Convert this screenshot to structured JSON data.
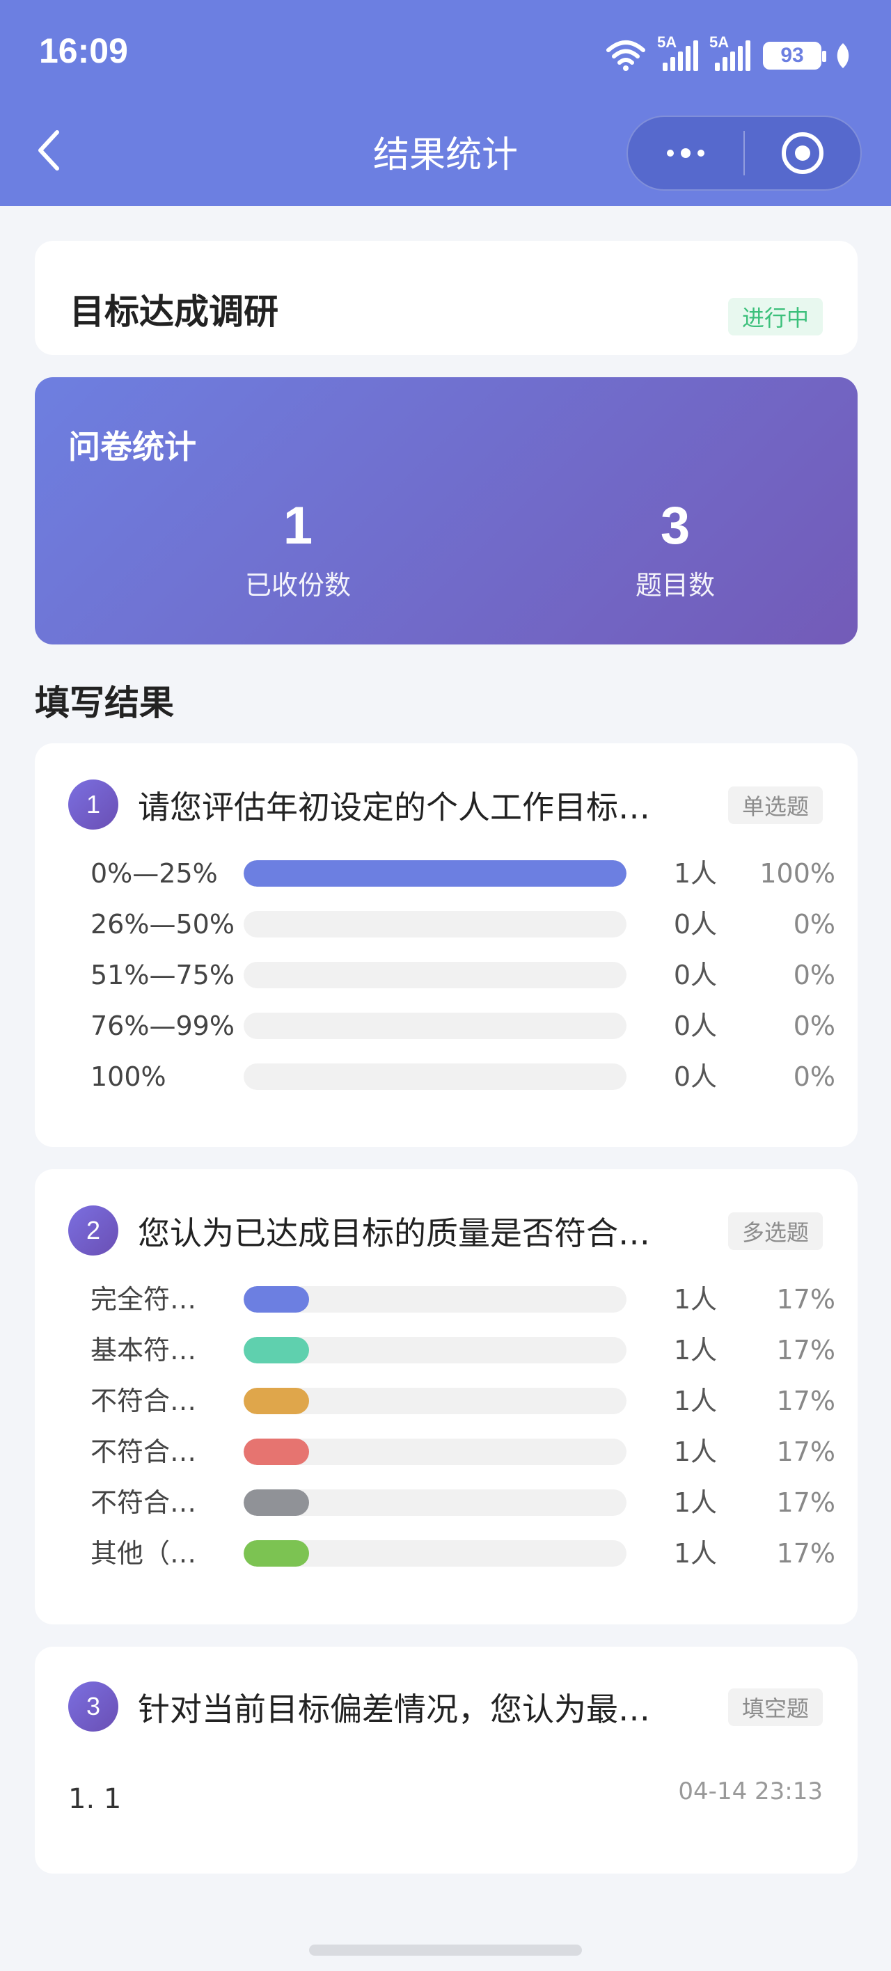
{
  "status_bar": {
    "time": "16:09",
    "signal1_label": "5A",
    "signal2_label": "5A",
    "battery": "93"
  },
  "nav": {
    "title": "结果统计"
  },
  "survey": {
    "title": "目标达成调研",
    "status": "进行中"
  },
  "stats": {
    "title": "问卷统计",
    "collected_value": "1",
    "collected_label": "已收份数",
    "questions_value": "3",
    "questions_label": "题目数"
  },
  "results_title": "填写结果",
  "questions": [
    {
      "number": "1",
      "text": "请您评估年初设定的个人工作目标…",
      "type": "单选题",
      "options": [
        {
          "label": "0%—25%",
          "count": "1人",
          "percent": "100%",
          "fraction": 1.0,
          "color": "#6c7fe1"
        },
        {
          "label": "26%—50%",
          "count": "0人",
          "percent": "0%",
          "fraction": 0,
          "color": "#6c7fe1"
        },
        {
          "label": "51%—75%",
          "count": "0人",
          "percent": "0%",
          "fraction": 0,
          "color": "#6c7fe1"
        },
        {
          "label": "76%—99%",
          "count": "0人",
          "percent": "0%",
          "fraction": 0,
          "color": "#6c7fe1"
        },
        {
          "label": "100%",
          "count": "0人",
          "percent": "0%",
          "fraction": 0,
          "color": "#6c7fe1"
        }
      ]
    },
    {
      "number": "2",
      "text": "您认为已达成目标的质量是否符合…",
      "type": "多选题",
      "options": [
        {
          "label": "完全符…",
          "count": "1人",
          "percent": "17%",
          "fraction": 0.17,
          "color": "#6c7fe1"
        },
        {
          "label": "基本符…",
          "count": "1人",
          "percent": "17%",
          "fraction": 0.17,
          "color": "#5fd0ae"
        },
        {
          "label": "不符合…",
          "count": "1人",
          "percent": "17%",
          "fraction": 0.17,
          "color": "#dfa64b"
        },
        {
          "label": "不符合…",
          "count": "1人",
          "percent": "17%",
          "fraction": 0.17,
          "color": "#e67470"
        },
        {
          "label": "不符合…",
          "count": "1人",
          "percent": "17%",
          "fraction": 0.17,
          "color": "#909297"
        },
        {
          "label": "其他（…",
          "count": "1人",
          "percent": "17%",
          "fraction": 0.17,
          "color": "#7cc352"
        }
      ]
    },
    {
      "number": "3",
      "text": "针对当前目标偏差情况，您认为最…",
      "type": "填空题",
      "answers": [
        {
          "text": "1. 1",
          "time": "04-14 23:13"
        }
      ]
    }
  ]
}
